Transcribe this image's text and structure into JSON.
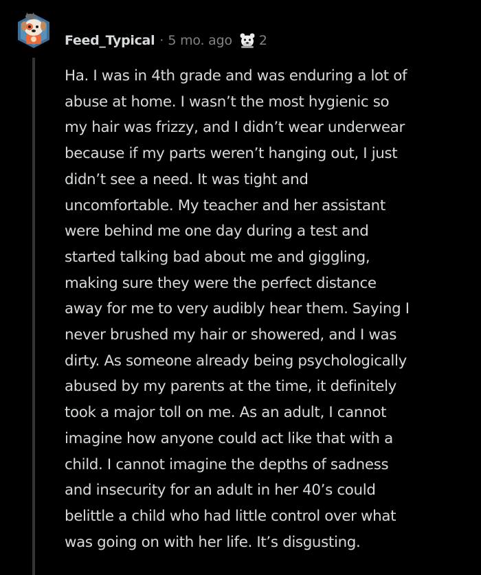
{
  "comment": {
    "username": "Feed_Typical",
    "separator": "·",
    "timestamp": "5 mo. ago",
    "award_icon": "bear-award-icon",
    "award_count": "2",
    "avatar_icon": "snoo-dog-avatar-icon",
    "body": "Ha. I was in 4th grade and was enduring a lot of\nabuse at home. I wasn’t the most hygienic so\nmy hair was frizzy, and I didn’t wear underwear\nbecause if my parts weren’t hanging out, I just\ndidn’t see a need. It was tight and\nuncomfortable. My teacher and her assistant\nwere behind me one day during a test and\nstarted talking bad about me and giggling,\nmaking sure they were the perfect distance\naway for me to very audibly hear them. Saying I\nnever brushed my hair or showered, and I was\ndirty. As someone already being psychologically\nabused by my parents at the time, it definitely\ntook a major toll on me. As an adult, I cannot\nimagine how anyone could act like that with a\nchild. I cannot imagine the depths of sadness\nand insecurity for an adult in her 40’s could\nbelittle a child who had little control over what\nwas going on with her life. It’s disgusting."
  },
  "colors": {
    "background": "#000000",
    "text": "#d7dadc",
    "muted": "#818384",
    "thread_line": "#343536",
    "avatar_bg": "#4a7fa8",
    "avatar_accent": "#e8643a"
  }
}
